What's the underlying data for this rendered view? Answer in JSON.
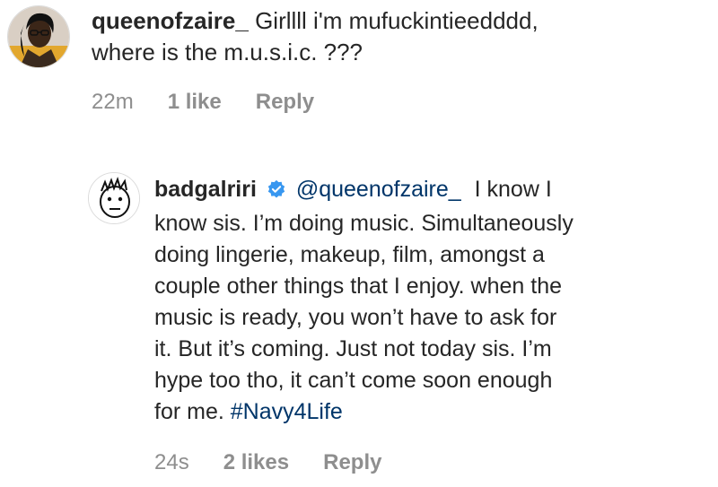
{
  "comment1": {
    "username": "queenofzaire_",
    "text": "Girllll i'm mufuckintieedddd,",
    "text_line2": "where is the m.u.s.i.c. ???",
    "time": "22m",
    "likes": "1 like",
    "reply_label": "Reply"
  },
  "comment2": {
    "username": "badgalriri",
    "mention": "@queenofzaire_",
    "lines": [
      "I know I",
      "know sis. I’m doing music. Simultaneously",
      "doing lingerie, makeup, film, amongst a",
      "couple other things that I enjoy. when the",
      "music is ready, you won’t have to ask for",
      "it. But it’s coming. Just not today sis. I’m",
      "hype too tho, it can’t come soon enough",
      "for me."
    ],
    "hashtag": "#Navy4Life",
    "time": "24s",
    "likes": "2 likes",
    "reply_label": "Reply"
  },
  "colors": {
    "text": "#262626",
    "meta": "#8e8e8e",
    "link": "#003569",
    "verified": "#3897f0"
  }
}
